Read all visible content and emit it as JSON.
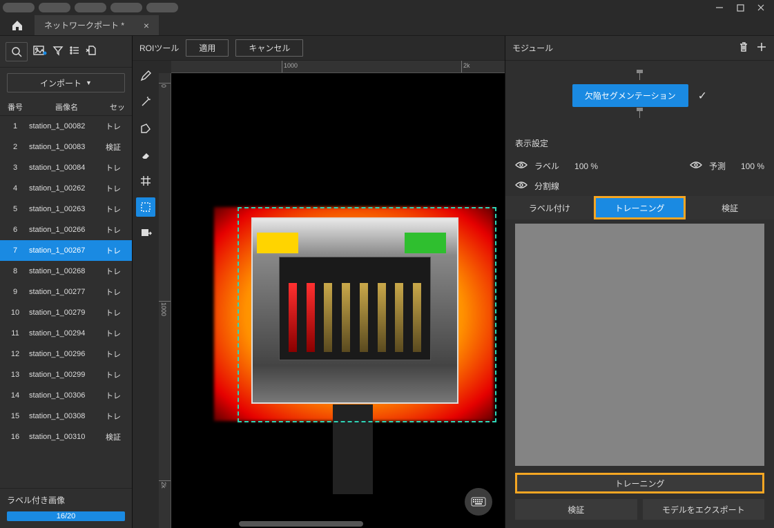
{
  "tab": {
    "title": "ネットワークポート *"
  },
  "left": {
    "import_label": "インポート",
    "header": {
      "num": "番号",
      "name": "画像名",
      "set": "セッ"
    },
    "rows": [
      {
        "n": "1",
        "name": "station_1_00082",
        "set": "トレ",
        "sel": false
      },
      {
        "n": "2",
        "name": "station_1_00083",
        "set": "検証",
        "sel": false
      },
      {
        "n": "3",
        "name": "station_1_00084",
        "set": "トレ",
        "sel": false
      },
      {
        "n": "4",
        "name": "station_1_00262",
        "set": "トレ",
        "sel": false
      },
      {
        "n": "5",
        "name": "station_1_00263",
        "set": "トレ",
        "sel": false
      },
      {
        "n": "6",
        "name": "station_1_00266",
        "set": "トレ",
        "sel": false
      },
      {
        "n": "7",
        "name": "station_1_00267",
        "set": "トレ",
        "sel": true
      },
      {
        "n": "8",
        "name": "station_1_00268",
        "set": "トレ",
        "sel": false
      },
      {
        "n": "9",
        "name": "station_1_00277",
        "set": "トレ",
        "sel": false
      },
      {
        "n": "10",
        "name": "station_1_00279",
        "set": "トレ",
        "sel": false
      },
      {
        "n": "11",
        "name": "station_1_00294",
        "set": "トレ",
        "sel": false
      },
      {
        "n": "12",
        "name": "station_1_00296",
        "set": "トレ",
        "sel": false
      },
      {
        "n": "13",
        "name": "station_1_00299",
        "set": "トレ",
        "sel": false
      },
      {
        "n": "14",
        "name": "station_1_00306",
        "set": "トレ",
        "sel": false
      },
      {
        "n": "15",
        "name": "station_1_00308",
        "set": "トレ",
        "sel": false
      },
      {
        "n": "16",
        "name": "station_1_00310",
        "set": "検証",
        "sel": false
      }
    ],
    "labeled": "ラベル付き画像",
    "progress": "16/20"
  },
  "roi": {
    "title": "ROIツール",
    "apply": "適用",
    "cancel": "キャンセル"
  },
  "ruler": {
    "h1": "1000",
    "h2": "2k",
    "v1": "0",
    "v2": "1000",
    "v3": "2k"
  },
  "right": {
    "module_title": "モジュール",
    "node": "欠陥セグメンテーション",
    "display": "表示設定",
    "label": "ラベル",
    "label_pct": "100 %",
    "pred": "予測",
    "pred_pct": "100 %",
    "seg": "分割線",
    "tabs": {
      "labeling": "ラベル付け",
      "training": "トレーニング",
      "verify": "検証"
    },
    "actions": {
      "train": "トレーニング",
      "verify": "検証",
      "export": "モデルをエクスポート"
    }
  }
}
